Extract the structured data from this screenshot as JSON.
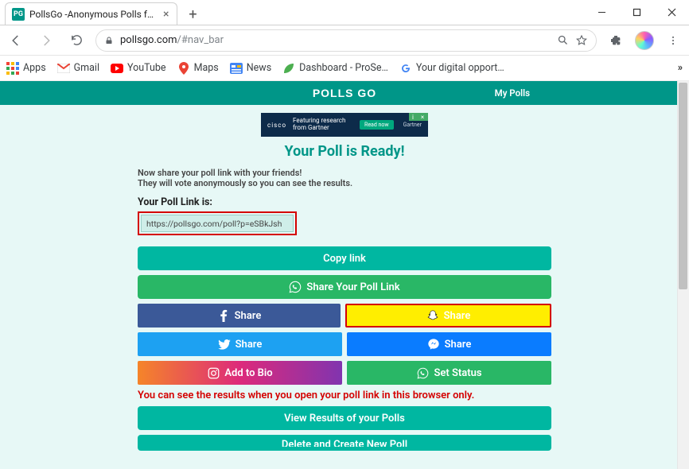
{
  "window": {
    "tab_title": "PollsGo -Anonymous Polls for W…",
    "favicon_text": "PG"
  },
  "toolbar": {
    "url_host": "pollsgo.com",
    "url_path": "/#nav_bar"
  },
  "bookmarks": {
    "apps": "Apps",
    "gmail": "Gmail",
    "youtube": "YouTube",
    "maps": "Maps",
    "news": "News",
    "dashboard": "Dashboard - ProSe…",
    "opport": "Your digital opport…"
  },
  "nav": {
    "brand": "POLLS GO",
    "my_polls": "My Polls"
  },
  "ad": {
    "vendor": "cisco",
    "line1": "Featuring research",
    "line2": "from Gartner",
    "cta": "Read now",
    "sponsor": "Gartner"
  },
  "page": {
    "headline": "Your Poll is Ready!",
    "sub1": "Now share your poll link with your friends!",
    "sub2": "They will vote anonymously so you can see the results.",
    "link_label": "Your Poll Link is:",
    "link_value": "https://pollsgo.com/poll?p=eSBkJsh",
    "copy": "Copy link",
    "share_wa": "Share Your Poll Link",
    "fb": "Share",
    "sc": "Share",
    "tw": "Share",
    "ms": "Share",
    "ig": "Add to Bio",
    "st": "Set Status",
    "warning": "You can see the results when you open your poll link in this browser only.",
    "view": "View Results of your Polls",
    "delete": "Delete and Create New Poll"
  }
}
